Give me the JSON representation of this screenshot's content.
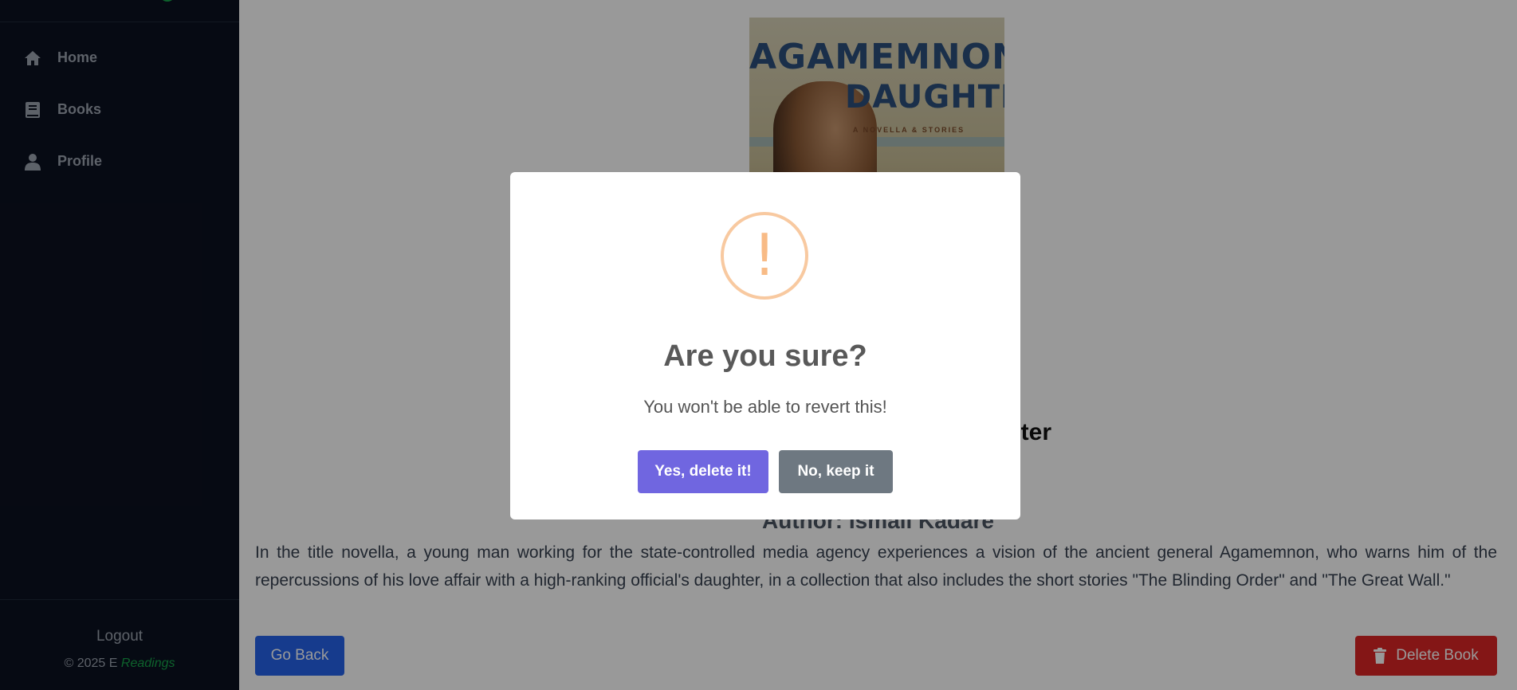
{
  "sidebar": {
    "items": [
      {
        "label": "Home",
        "icon": "home-icon"
      },
      {
        "label": "Books",
        "icon": "book-icon"
      },
      {
        "label": "Profile",
        "icon": "user-icon"
      }
    ],
    "logout_label": "Logout",
    "copyright_prefix": "© 2025 E",
    "copyright_brand": "Readings"
  },
  "book": {
    "cover_title_line1": "AGAMEMNON'S",
    "cover_title_line2": "DAUGHTER",
    "cover_subtitle": "A NOVELLA & STORIES",
    "title_visible_fragment": "ghter",
    "author": "Author: Ismail Kadare",
    "description": "In the title novella, a young man working for the state-controlled media agency experiences a vision of the ancient general Agamemnon, who warns him of the repercussions of his love affair with a high-ranking official's daughter, in a collection that also includes the short stories \"The Blinding Order\" and \"The Great Wall.\""
  },
  "actions": {
    "go_back_label": "Go Back",
    "delete_label": "Delete Book"
  },
  "modal": {
    "icon": "!",
    "title": "Are you sure?",
    "text": "You won't be able to revert this!",
    "confirm_label": "Yes, delete it!",
    "cancel_label": "No, keep it"
  },
  "colors": {
    "sidebar_bg": "#0b1120",
    "brand_accent": "#16a34a",
    "primary_button": "#2563eb",
    "danger_button": "#dc2626",
    "confirm_button": "#7066e0",
    "cancel_button": "#6e7881",
    "warning_icon": "#f8bb86"
  }
}
